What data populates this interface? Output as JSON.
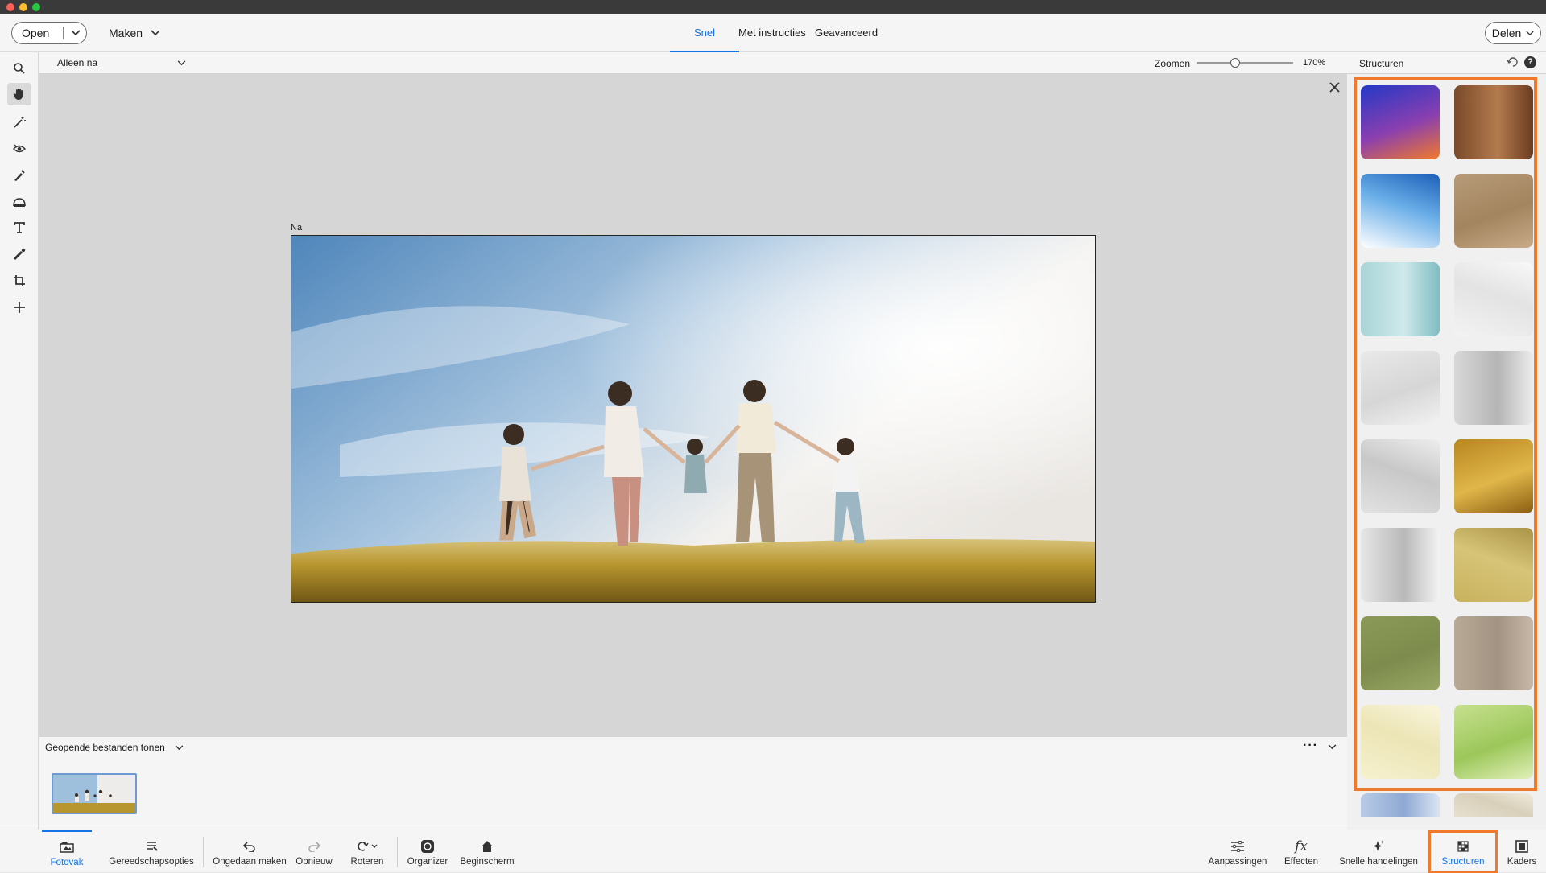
{
  "topbar": {
    "open_label": "Open",
    "create_label": "Maken",
    "tabs": [
      {
        "label": "Snel",
        "active": true
      },
      {
        "label": "Met instructies",
        "active": false
      },
      {
        "label": "Geavanceerd",
        "active": false
      }
    ],
    "share_label": "Delen"
  },
  "options_bar": {
    "view_select": "Alleen na",
    "zoom_label": "Zoomen",
    "zoom_value": "170%",
    "zoom_level": 0.4,
    "panel_title": "Structuren"
  },
  "tools": [
    "zoom-icon",
    "hand-icon",
    "quick-select-icon",
    "red-eye-icon",
    "whiten-teeth-icon",
    "straighten-icon",
    "text-icon",
    "spot-healing-icon",
    "crop-icon",
    "move-icon"
  ],
  "canvas": {
    "view_caption": "Na"
  },
  "structures": {
    "accent_color": "#f07a2a",
    "swatches": [
      {
        "name": "gradient-blue-orange",
        "colors": [
          "#2438c6",
          "#8a3fb0",
          "#f07a2a"
        ]
      },
      {
        "name": "wood-grain",
        "colors": [
          "#7a4a2a",
          "#b37a4e",
          "#6b3c20"
        ]
      },
      {
        "name": "blue-watercolor",
        "colors": [
          "#ffffff",
          "#6aaee8",
          "#1b5fb8"
        ]
      },
      {
        "name": "burlap",
        "colors": [
          "#b79a78",
          "#a3855f",
          "#c8aa88"
        ]
      },
      {
        "name": "teal-pattern",
        "colors": [
          "#a9d4d8",
          "#cfe9ea",
          "#7fbcc2"
        ]
      },
      {
        "name": "white-paper",
        "colors": [
          "#f3f3f3",
          "#e3e3e3",
          "#f8f8f8"
        ]
      },
      {
        "name": "linen-white",
        "colors": [
          "#e9e9e9",
          "#d6d6d6",
          "#f2f2f2"
        ]
      },
      {
        "name": "crumpled-paper",
        "colors": [
          "#d8d8d8",
          "#b5b5b5",
          "#ececec"
        ]
      },
      {
        "name": "grey-canvas",
        "colors": [
          "#e2e2e2",
          "#c8c8c8",
          "#ededed"
        ]
      },
      {
        "name": "gold-foil",
        "colors": [
          "#b8861f",
          "#e0b64a",
          "#8a5e10"
        ]
      },
      {
        "name": "cracked-paint",
        "colors": [
          "#e6e6e6",
          "#b9b9b9",
          "#f3f3f3"
        ]
      },
      {
        "name": "gold-weave",
        "colors": [
          "#c7b25e",
          "#d8c477",
          "#a99448"
        ]
      },
      {
        "name": "olive-green",
        "colors": [
          "#8b9a58",
          "#7d8c4c",
          "#98a665"
        ]
      },
      {
        "name": "brown-fabric",
        "colors": [
          "#b8a896",
          "#a39382",
          "#c7b8a8"
        ]
      },
      {
        "name": "cream-stripes",
        "colors": [
          "#f6f1cf",
          "#ece5b6",
          "#faf6de"
        ]
      },
      {
        "name": "green-burst",
        "colors": [
          "#c7e08f",
          "#9cc75a",
          "#e0efb8"
        ]
      },
      {
        "name": "blue-speckle",
        "colors": [
          "#b9cbe6",
          "#8ea9d4",
          "#dbe5f3"
        ]
      },
      {
        "name": "beige-linen",
        "colors": [
          "#e6e0cf",
          "#d8d0ba",
          "#efeadc"
        ]
      }
    ]
  },
  "filmstrip": {
    "label": "Geopende bestanden tonen"
  },
  "bottom_left": [
    {
      "label": "Fotovak",
      "icon": "photo-bin-icon",
      "active": true
    },
    {
      "label": "Gereedschapsopties",
      "icon": "tool-options-icon"
    },
    {
      "label": "Ongedaan maken",
      "icon": "undo-icon"
    },
    {
      "label": "Opnieuw",
      "icon": "redo-icon"
    },
    {
      "label": "Roteren",
      "icon": "rotate-icon"
    },
    {
      "label": "Organizer",
      "icon": "organizer-icon"
    },
    {
      "label": "Beginscherm",
      "icon": "home-icon"
    }
  ],
  "bottom_right": [
    {
      "label": "Aanpassingen",
      "icon": "adjustments-icon"
    },
    {
      "label": "Effecten",
      "icon": "effects-icon"
    },
    {
      "label": "Snelle handelingen",
      "icon": "quick-actions-icon"
    },
    {
      "label": "Structuren",
      "icon": "textures-icon",
      "active": true
    },
    {
      "label": "Kaders",
      "icon": "frames-icon"
    }
  ]
}
